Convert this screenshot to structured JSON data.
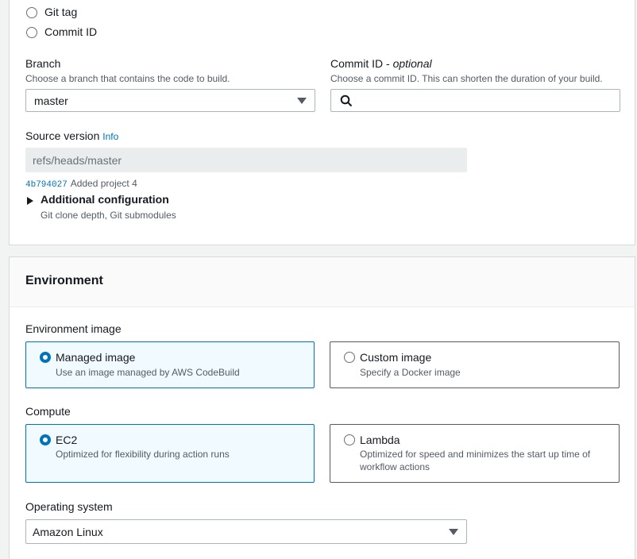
{
  "source": {
    "radio_options": [
      {
        "label": "Git tag",
        "selected": false
      },
      {
        "label": "Commit ID",
        "selected": false
      }
    ],
    "branch": {
      "label": "Branch",
      "description": "Choose a branch that contains the code to build.",
      "value": "master"
    },
    "commit": {
      "label": "Commit ID - ",
      "label_optional": "optional",
      "description": "Choose a commit ID. This can shorten the duration of your build.",
      "value": ""
    },
    "source_version": {
      "label": "Source version",
      "info": "Info",
      "value": "refs/heads/master",
      "commit_hash": "4b794027",
      "commit_message": "Added project 4"
    },
    "additional_config": {
      "title": "Additional configuration",
      "description": "Git clone depth, Git submodules"
    }
  },
  "environment": {
    "title": "Environment",
    "image": {
      "label": "Environment image",
      "options": [
        {
          "title": "Managed image",
          "description": "Use an image managed by AWS CodeBuild",
          "selected": true
        },
        {
          "title": "Custom image",
          "description": "Specify a Docker image",
          "selected": false
        }
      ]
    },
    "compute": {
      "label": "Compute",
      "options": [
        {
          "title": "EC2",
          "description": "Optimized for flexibility during action runs",
          "selected": true
        },
        {
          "title": "Lambda",
          "description_line1": "Optimized for speed and minimizes the start up time of",
          "description_line2": "workflow actions",
          "selected": false
        }
      ]
    },
    "os": {
      "label": "Operating system",
      "value": "Amazon Linux"
    }
  },
  "colors": {
    "accent": "#0073bb",
    "selected_tile_bg": "#f1faff",
    "text": "#16191f",
    "muted": "#545b64"
  }
}
